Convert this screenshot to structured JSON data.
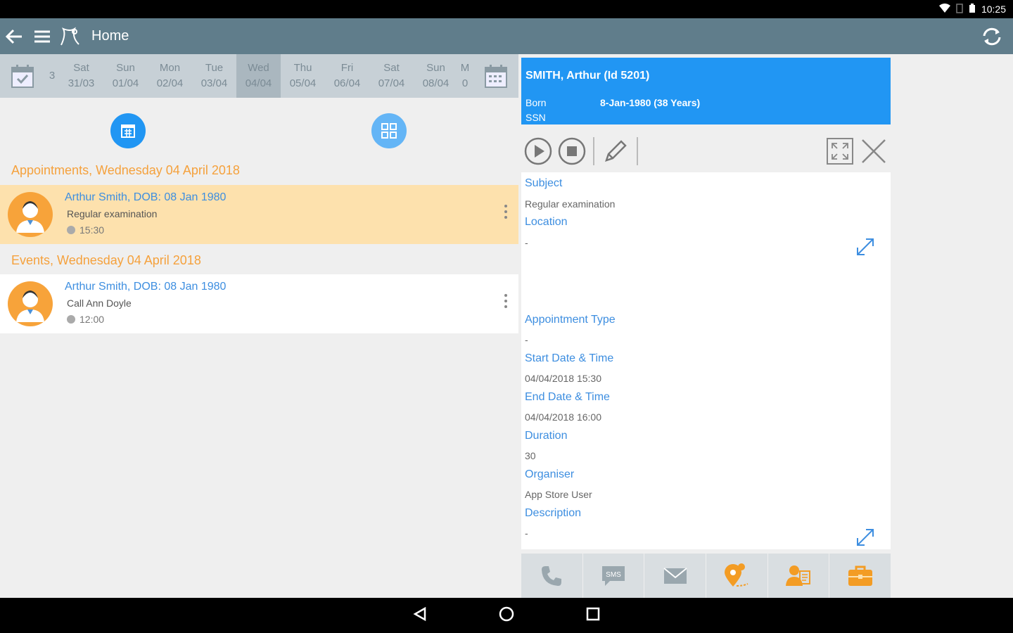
{
  "status_bar": {
    "time": "10:25"
  },
  "app_bar": {
    "title": "Home"
  },
  "date_strip": {
    "days": [
      {
        "day": "",
        "date": "3",
        "partial": true
      },
      {
        "day": "Sat",
        "date": "31/03"
      },
      {
        "day": "Sun",
        "date": "01/04"
      },
      {
        "day": "Mon",
        "date": "02/04"
      },
      {
        "day": "Tue",
        "date": "03/04"
      },
      {
        "day": "Wed",
        "date": "04/04",
        "selected": true
      },
      {
        "day": "Thu",
        "date": "05/04"
      },
      {
        "day": "Fri",
        "date": "06/04"
      },
      {
        "day": "Sat",
        "date": "07/04"
      },
      {
        "day": "Sun",
        "date": "08/04"
      },
      {
        "day": "M",
        "date": "0",
        "partial": true
      }
    ]
  },
  "appointments": {
    "header": "Appointments, Wednesday 04 April 2018",
    "items": [
      {
        "name": "Arthur Smith, DOB: 08 Jan 1980",
        "subject": "Regular examination",
        "time": "15:30"
      }
    ]
  },
  "events": {
    "header": "Events, Wednesday 04 April 2018",
    "items": [
      {
        "name": "Arthur Smith, DOB: 08 Jan 1980",
        "subject": "Call Ann Doyle",
        "time": "12:00"
      }
    ]
  },
  "patient": {
    "name": "SMITH, Arthur (Id 5201)",
    "born_label": "Born",
    "born_value": "8-Jan-1980 (38 Years)",
    "ssn_label": "SSN"
  },
  "details": {
    "subject_label": "Subject",
    "subject_value": "Regular examination",
    "location_label": "Location",
    "location_value": "-",
    "appt_type_label": "Appointment Type",
    "appt_type_value": "-",
    "start_label": "Start Date & Time",
    "start_value": "04/04/2018 15:30",
    "end_label": "End Date & Time",
    "end_value": "04/04/2018 16:00",
    "duration_label": "Duration",
    "duration_value": "30",
    "organiser_label": "Organiser",
    "organiser_value": "App Store User",
    "description_label": "Description",
    "description_value": "-"
  },
  "actions": {
    "sms_label": "SMS"
  },
  "colors": {
    "app_bar": "#607d8b",
    "accent_blue": "#2196f3",
    "orange": "#f5a13c",
    "selected_row": "#fde1ad"
  }
}
